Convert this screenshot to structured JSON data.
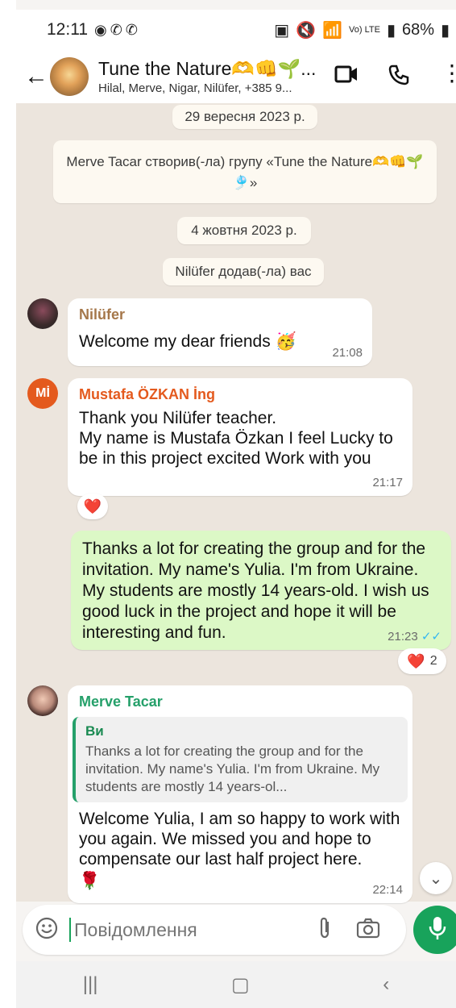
{
  "status_bar": {
    "time": "12:11",
    "battery": "68%",
    "network": "Vo) LTE"
  },
  "header": {
    "title": "Tune the Nature🫶👊🌱...",
    "subtitle": "Hilal, Merve, Nigar, Nilüfer, +385 9..."
  },
  "chips": {
    "date1": "29 вересня 2023 р.",
    "system_created": "Merve Tacar створив(-ла) групу «Tune the Nature🫶👊🌱🎐»",
    "date2": "4 жовтня 2023 р.",
    "system_added": "Nilüfer додав(-ла) вас"
  },
  "messages": [
    {
      "sender": "Nilüfer",
      "text": "Welcome my dear friends 🥳",
      "time": "21:08"
    },
    {
      "sender": "Mustafa ÖZKAN İng",
      "avatar_text": "Mİ",
      "text": "Thank you Nilüfer teacher.\nMy name is Mustafa Özkan I feel Lucky to be in this project excited Work with you",
      "time": "21:17",
      "reaction": "❤️"
    },
    {
      "text": "Thanks a lot for creating the group and for the invitation. My name's Yulia. I'm from Ukraine. My students are mostly 14 years-old. I wish us good luck in  the project and hope it will be interesting and fun.",
      "time": "21:23",
      "ticks": "✓✓",
      "reaction": "❤️",
      "reaction_count": "2"
    },
    {
      "sender": "Merve Tacar",
      "quote_name": "Ви",
      "quote_text": "Thanks a lot for creating the group and for the invitation. My name's Yulia. I'm from Ukraine. My students are mostly 14 years-ol...",
      "text": "Welcome Yulia, I am so happy to work with you again. We missed you and hope to compensate our last half project here.",
      "emoji": "🌹",
      "time": "22:14"
    }
  ],
  "composer": {
    "placeholder": "Повідомлення"
  },
  "colors": {
    "chat_bg": "#ece5dd",
    "outgoing": "#dcf8c6",
    "accent_green": "#18a35b",
    "sender_nilufer": "#a5774a",
    "sender_mustafa": "#e45a1e",
    "sender_merve": "#25a06a",
    "read_tick": "#34b7f1"
  },
  "icons": {
    "back": "back-arrow-icon",
    "video": "video-call-icon",
    "phone": "voice-call-icon",
    "menu": "more-vert-icon",
    "emoji": "emoji-icon",
    "attach": "paperclip-icon",
    "camera": "camera-icon",
    "mic": "microphone-icon"
  }
}
